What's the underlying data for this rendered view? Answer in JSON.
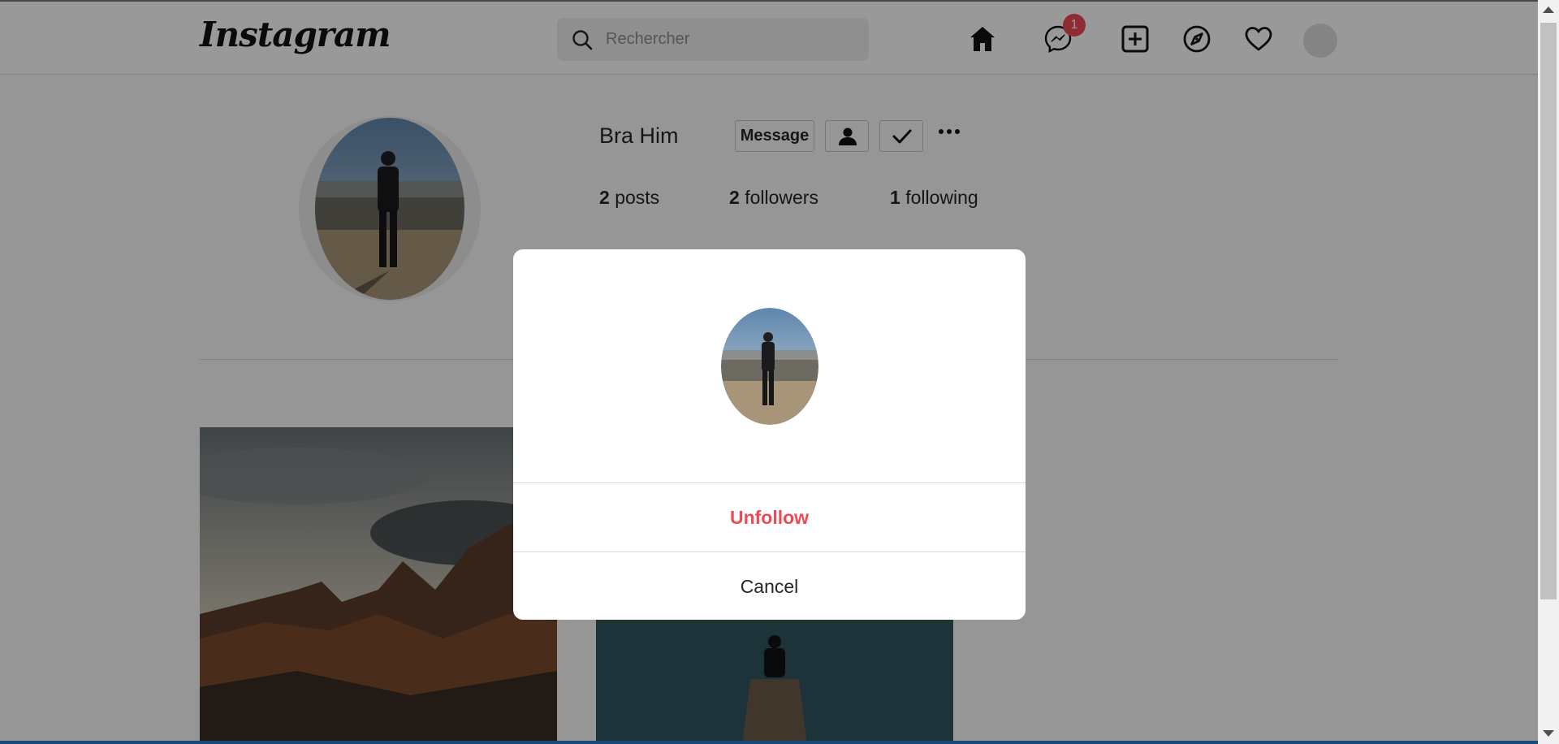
{
  "header": {
    "logo": "Instagram",
    "search": {
      "placeholder": "Rechercher"
    },
    "icons": [
      "home-icon",
      "messenger-icon",
      "add-post-icon",
      "explore-icon",
      "activity-heart-icon",
      "avatar"
    ],
    "messages_badge": "1"
  },
  "profile": {
    "username": "Bra Him",
    "message_button": "Message",
    "stats": {
      "posts_count": "2",
      "posts_label": "posts",
      "followers_count": "2",
      "followers_label": "followers",
      "following_count": "1",
      "following_label": "following"
    }
  },
  "modal": {
    "unfollow_label": "Unfollow",
    "cancel_label": "Cancel"
  },
  "colors": {
    "unfollow": "#ed4956",
    "badge": "#ed4956",
    "overlay": "rgba(0,0,0,0.4)"
  }
}
